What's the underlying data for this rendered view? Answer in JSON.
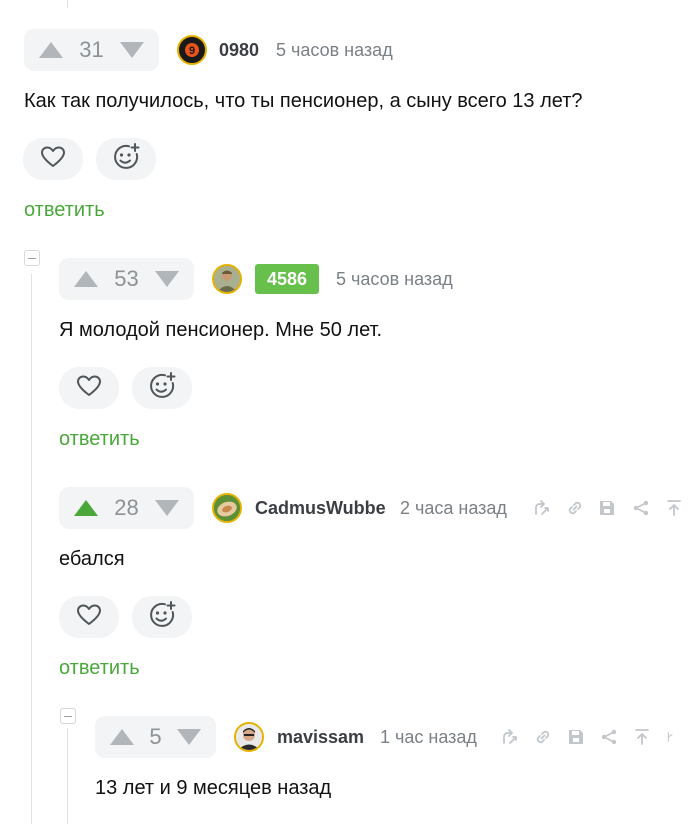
{
  "comments": [
    {
      "votes": "31",
      "username": "0980",
      "time": "5 часов назад",
      "text": "Как так получилось, что ты пенсионер, а сыну всего 13 лет?",
      "reply_label": "ответить"
    },
    {
      "votes": "53",
      "badge": "4586",
      "time": "5 часов назад",
      "text": "Я молодой пенсионер. Мне 50 лет.",
      "reply_label": "ответить"
    },
    {
      "votes": "28",
      "upvoted": true,
      "username": "CadmusWubbe",
      "time": "2 часа назад",
      "text": "ебался",
      "reply_label": "ответить"
    },
    {
      "votes": "5",
      "username": "mavissam",
      "time": "1 час назад",
      "text": "13 лет и 9 месяцев назад"
    }
  ],
  "icons": {
    "vote_up": "triangle-up-icon",
    "vote_down": "triangle-down-icon",
    "like": "heart-icon",
    "reaction": "smiley-add-icon",
    "tools": [
      "branch-icon",
      "link-icon",
      "save-icon",
      "share-icon",
      "to-top-icon"
    ]
  },
  "colors": {
    "accent_green": "#4aa83a",
    "badge_green": "#67c04b",
    "upvoted_green": "#4aa83a",
    "vote_arrow_gray": "#b1b6ba",
    "pill_bg": "#f2f4f5"
  }
}
